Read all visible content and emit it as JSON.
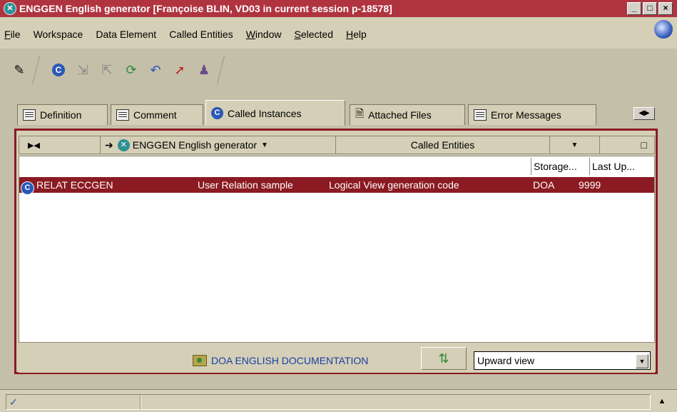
{
  "window": {
    "title": "ENGGEN English generator [Françoise BLIN, VD03 in current session p-18578]",
    "title_icon": "x-circle-icon",
    "minimize": "_",
    "maximize": "□",
    "close": "×"
  },
  "menu": [
    "File",
    "Workspace",
    "Data Element",
    "Called Entities",
    "Window",
    "Selected",
    "Help"
  ],
  "toolbar": {
    "icons": [
      "pin-icon",
      "c-entity-icon",
      "expand-icon",
      "collapse-icon",
      "refresh-icon",
      "undo-icon",
      "jump-arrow-icon",
      "users-icon"
    ]
  },
  "tabs": [
    {
      "label": "Definition",
      "icon": "edit-doc-icon"
    },
    {
      "label": "Comment",
      "icon": "doc-lines-icon"
    },
    {
      "label": "Called Instances",
      "icon": "c-entity-icon",
      "active": true
    },
    {
      "label": "Attached Files",
      "icon": "file-icon"
    },
    {
      "label": "Error Messages",
      "icon": "doc-lines-icon"
    }
  ],
  "nav": {
    "entity": "ENGGEN English generator",
    "view": "Called Entities"
  },
  "columns": [
    "Storage...",
    "Last Up..."
  ],
  "rows": [
    {
      "code": "RELAT ECCGEN",
      "type": "User Relation sample",
      "desc": "Logical View generation code",
      "storage": "DOA",
      "last": "9999"
    }
  ],
  "footer": {
    "doc_label": "DOA ENGLISH DOCUMENTATION",
    "view_select": "Upward view"
  },
  "colors": {
    "title_bar": "#b03440",
    "selection": "#8b1a22",
    "accent": "#2a58b8"
  },
  "status": {
    "check": "✓",
    "scroll": "▲"
  }
}
